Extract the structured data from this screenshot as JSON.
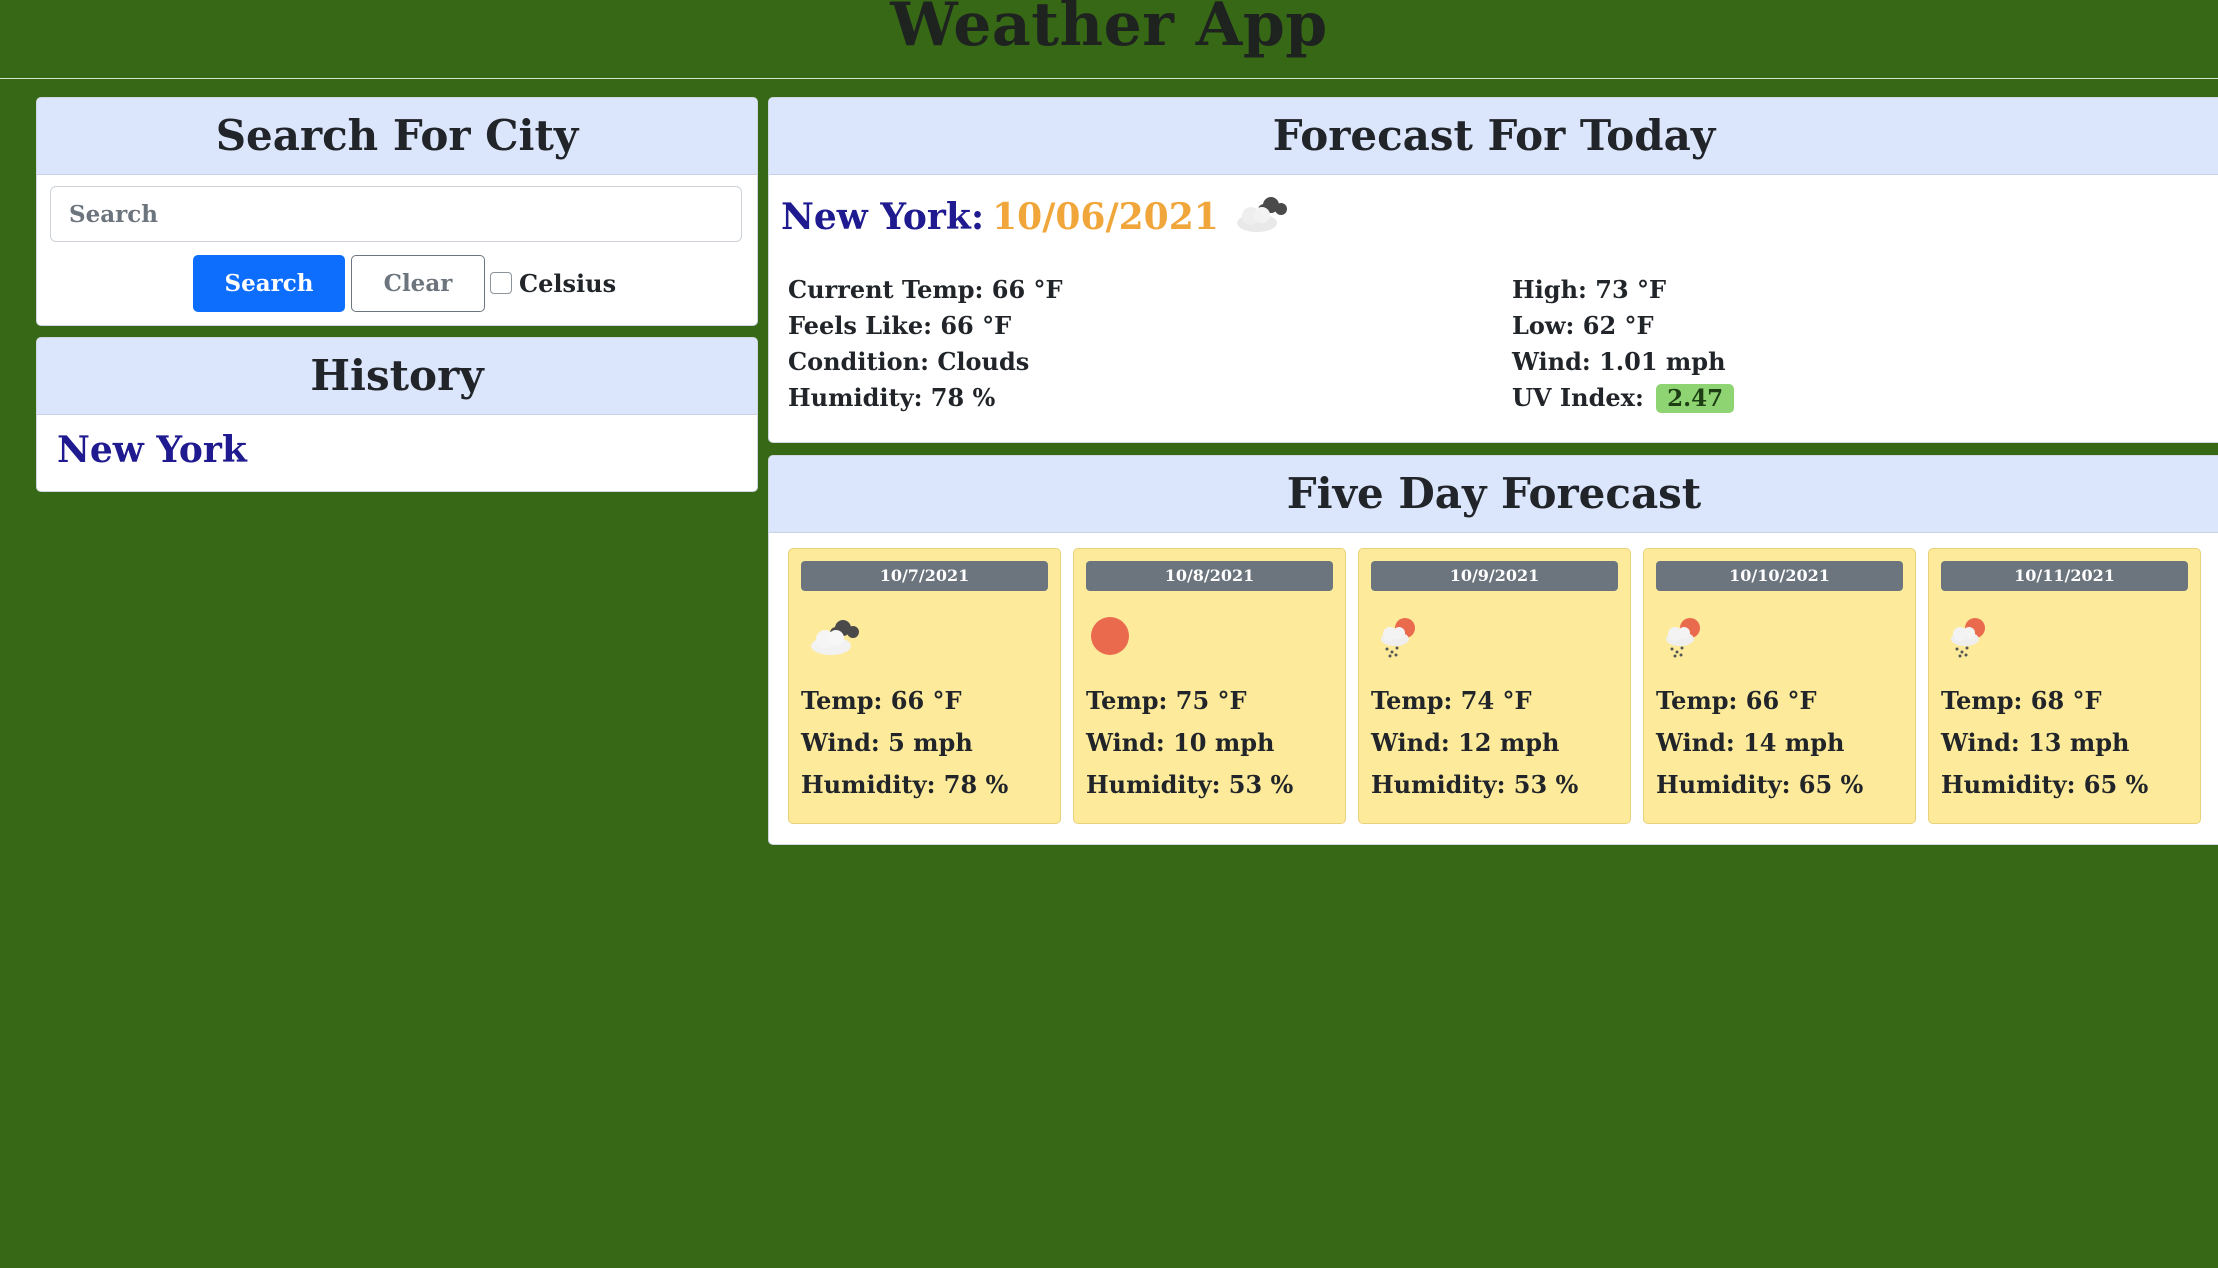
{
  "app": {
    "title": "Weather App"
  },
  "search": {
    "title": "Search For City",
    "placeholder": "Search",
    "value": "",
    "search_label": "Search",
    "clear_label": "Clear",
    "celsius_label": "Celsius",
    "celsius_checked": false
  },
  "history": {
    "title": "History",
    "items": [
      "New York"
    ]
  },
  "today": {
    "title": "Forecast For Today",
    "city": "New York:",
    "date": "10/06/2021",
    "icon": "clouds-icon",
    "current_temp": "Current Temp: 66 °F",
    "feels_like": "Feels Like: 66 °F",
    "condition": "Condition: Clouds",
    "humidity": "Humidity: 78 %",
    "high": "High: 73 °F",
    "low": "Low: 62 °F",
    "wind": "Wind: 1.01 mph",
    "uv_label": "UV Index:",
    "uv_value": "2.47"
  },
  "forecast": {
    "title": "Five Day Forecast",
    "days": [
      {
        "date": "10/7/2021",
        "icon": "clouds-icon",
        "temp": "Temp: 66 °F",
        "wind": "Wind: 5 mph",
        "humidity": "Humidity: 78 %"
      },
      {
        "date": "10/8/2021",
        "icon": "sun-icon",
        "temp": "Temp: 75 °F",
        "wind": "Wind: 10 mph",
        "humidity": "Humidity: 53 %"
      },
      {
        "date": "10/9/2021",
        "icon": "rain-sun-icon",
        "temp": "Temp: 74 °F",
        "wind": "Wind: 12 mph",
        "humidity": "Humidity: 53 %"
      },
      {
        "date": "10/10/2021",
        "icon": "rain-sun-icon",
        "temp": "Temp: 66 °F",
        "wind": "Wind: 14 mph",
        "humidity": "Humidity: 65 %"
      },
      {
        "date": "10/11/2021",
        "icon": "rain-sun-icon",
        "temp": "Temp: 68 °F",
        "wind": "Wind: 13 mph",
        "humidity": "Humidity: 65 %"
      }
    ]
  },
  "colors": {
    "background": "#366816",
    "card_header": "#dbe5fb",
    "city": "#1f1a8f",
    "date": "#f0a63a",
    "primary_button": "#0d6efd",
    "uv_badge": "#8fd473",
    "day_card": "#fdeb9b",
    "day_date_badge": "#6c757d"
  }
}
